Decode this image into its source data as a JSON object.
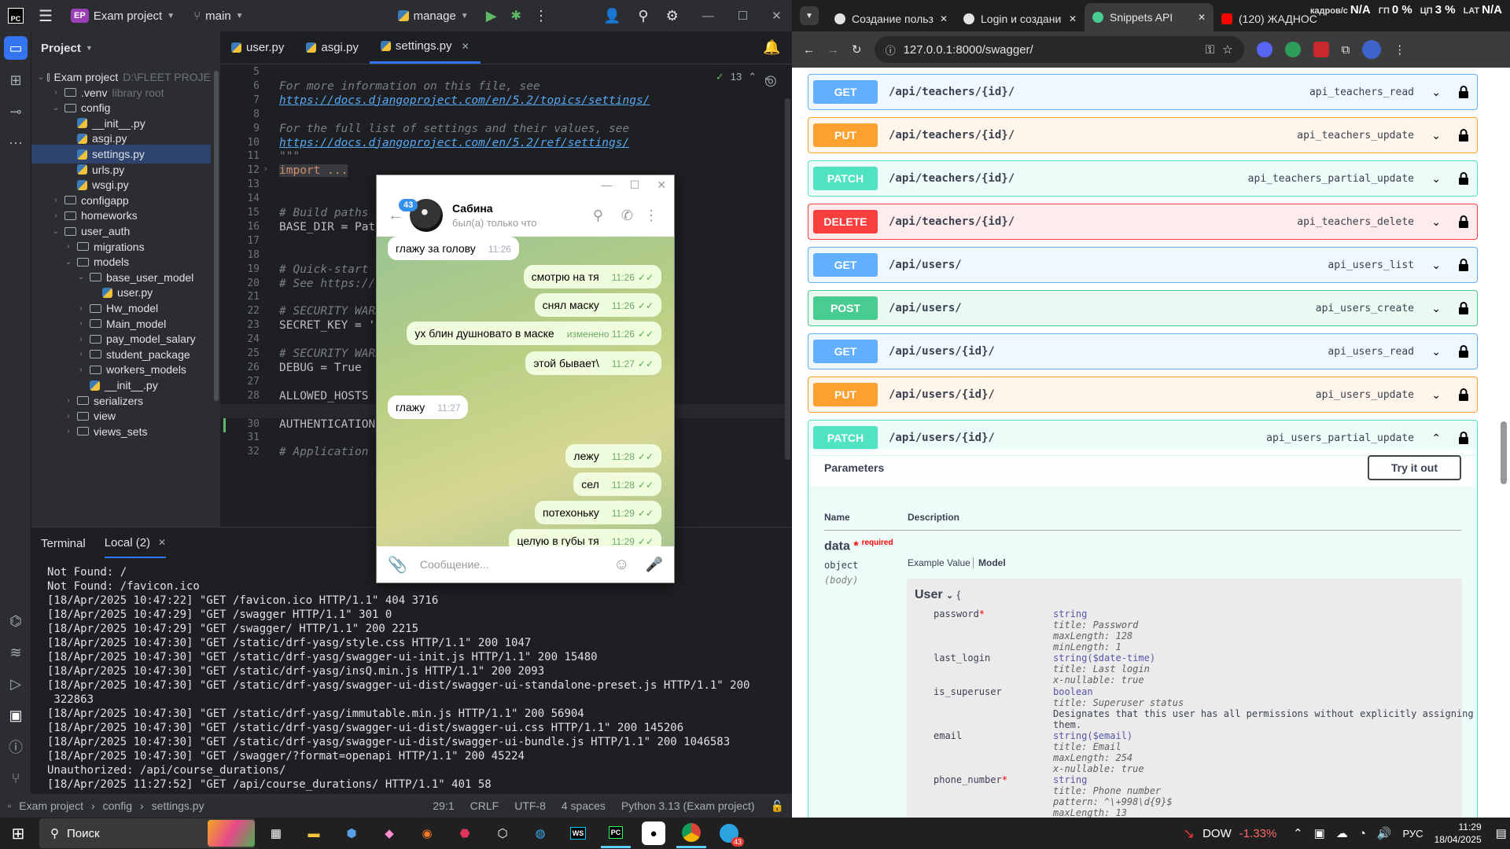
{
  "ide": {
    "logo": "PC",
    "project_badge": "EP",
    "project_name": "Exam project",
    "branch": "main",
    "run_config": "manage",
    "panel_title": "Project",
    "tree": [
      {
        "label": "Exam project",
        "hint": "D:\\FLEET PROJE",
        "kind": "folder",
        "depth": 0,
        "open": true
      },
      {
        "label": ".venv",
        "hint": "library root",
        "kind": "folder",
        "depth": 1,
        "open": false
      },
      {
        "label": "config",
        "hint": "",
        "kind": "folder",
        "depth": 1,
        "open": true
      },
      {
        "label": "__init__.py",
        "hint": "",
        "kind": "py",
        "depth": 2
      },
      {
        "label": "asgi.py",
        "hint": "",
        "kind": "py",
        "depth": 2
      },
      {
        "label": "settings.py",
        "hint": "",
        "kind": "py",
        "depth": 2,
        "selected": true
      },
      {
        "label": "urls.py",
        "hint": "",
        "kind": "py",
        "depth": 2
      },
      {
        "label": "wsgi.py",
        "hint": "",
        "kind": "py",
        "depth": 2
      },
      {
        "label": "configapp",
        "hint": "",
        "kind": "folder",
        "depth": 1,
        "open": false
      },
      {
        "label": "homeworks",
        "hint": "",
        "kind": "folder",
        "depth": 1,
        "open": false
      },
      {
        "label": "user_auth",
        "hint": "",
        "kind": "folder",
        "depth": 1,
        "open": true
      },
      {
        "label": "migrations",
        "hint": "",
        "kind": "folder",
        "depth": 2,
        "open": false
      },
      {
        "label": "models",
        "hint": "",
        "kind": "folder",
        "depth": 2,
        "open": true
      },
      {
        "label": "base_user_model",
        "hint": "",
        "kind": "folder",
        "depth": 3,
        "open": true
      },
      {
        "label": "user.py",
        "hint": "",
        "kind": "py",
        "depth": 4
      },
      {
        "label": "Hw_model",
        "hint": "",
        "kind": "folder",
        "depth": 3,
        "open": false
      },
      {
        "label": "Main_model",
        "hint": "",
        "kind": "folder",
        "depth": 3,
        "open": false
      },
      {
        "label": "pay_model_salary",
        "hint": "",
        "kind": "folder",
        "depth": 3,
        "open": false
      },
      {
        "label": "student_package",
        "hint": "",
        "kind": "folder",
        "depth": 3,
        "open": false
      },
      {
        "label": "workers_models",
        "hint": "",
        "kind": "folder",
        "depth": 3,
        "open": false
      },
      {
        "label": "__init__.py",
        "hint": "",
        "kind": "py",
        "depth": 3
      },
      {
        "label": "serializers",
        "hint": "",
        "kind": "folder",
        "depth": 2,
        "open": false
      },
      {
        "label": "view",
        "hint": "",
        "kind": "folder",
        "depth": 2,
        "open": false
      },
      {
        "label": "views_sets",
        "hint": "",
        "kind": "folder",
        "depth": 2,
        "open": false
      }
    ],
    "tabs": [
      "user.py",
      "asgi.py",
      "settings.py"
    ],
    "active_tab": "settings.py",
    "inspection_count": "13",
    "lines": [
      {
        "n": "5",
        "t": ""
      },
      {
        "n": "6",
        "t": "For more information on this file, see",
        "c": "cm"
      },
      {
        "n": "7",
        "t": "https://docs.djangoproject.com/en/5.2/topics/settings/",
        "c": "lk"
      },
      {
        "n": "8",
        "t": ""
      },
      {
        "n": "9",
        "t": "For the full list of settings and their values, see",
        "c": "cm"
      },
      {
        "n": "10",
        "t": "https://docs.djangoproject.com/en/5.2/ref/settings/",
        "c": "lk"
      },
      {
        "n": "11",
        "t": "\"\"\"",
        "c": "cm"
      },
      {
        "n": "12",
        "t": "import ...",
        "c": "kw"
      },
      {
        "n": "13",
        "t": ""
      },
      {
        "n": "14",
        "t": ""
      },
      {
        "n": "15",
        "t": "# Build paths i",
        "c": "cm"
      },
      {
        "n": "16",
        "t": "BASE_DIR = Path",
        "c": ""
      },
      {
        "n": "17",
        "t": ""
      },
      {
        "n": "18",
        "t": ""
      },
      {
        "n": "19",
        "t": "# Quick-start de",
        "c": "cm"
      },
      {
        "n": "20",
        "t": "# See https://d",
        "c": "cm"
      },
      {
        "n": "21",
        "t": ""
      },
      {
        "n": "22",
        "t": "# SECURITY WARNI",
        "c": "cm"
      },
      {
        "n": "23",
        "t": "SECRET_KEY = 'dj",
        "c": ""
      },
      {
        "n": "24",
        "t": ""
      },
      {
        "n": "25",
        "t": "# SECURITY WARNI",
        "c": "cm"
      },
      {
        "n": "26",
        "t": "DEBUG = True",
        "c": ""
      },
      {
        "n": "27",
        "t": ""
      },
      {
        "n": "28",
        "t": "ALLOWED_HOSTS =",
        "c": ""
      },
      {
        "n": "29",
        "t": ""
      },
      {
        "n": "30",
        "t": "AUTHENTICATION_",
        "c": ""
      },
      {
        "n": "31",
        "t": ""
      },
      {
        "n": "32",
        "t": "# Application de",
        "c": "cm"
      }
    ],
    "right_fragments": {
      "l15": ".",
      "l20": "ecklist/",
      "l22": "et!",
      "l23": "l=5n-q#&^3!y",
      "l25": "n!",
      "l30": "ackend']"
    },
    "terminal_tabs": [
      "Terminal",
      "Local (2)"
    ],
    "terminal_lines": [
      "Not Found: /",
      "Not Found: /favicon.ico",
      "[18/Apr/2025 10:47:22] \"GET /favicon.ico HTTP/1.1\" 404 3716",
      "[18/Apr/2025 10:47:29] \"GET /swagger HTTP/1.1\" 301 0",
      "[18/Apr/2025 10:47:29] \"GET /swagger/ HTTP/1.1\" 200 2215",
      "[18/Apr/2025 10:47:30] \"GET /static/drf-yasg/style.css HTTP/1.1\" 200 1047",
      "[18/Apr/2025 10:47:30] \"GET /static/drf-yasg/swagger-ui-init.js HTTP/1.1\" 200 15480",
      "[18/Apr/2025 10:47:30] \"GET /static/drf-yasg/insQ.min.js HTTP/1.1\" 200 2093",
      "[18/Apr/2025 10:47:30] \"GET /static/drf-yasg/swagger-ui-dist/swagger-ui-standalone-preset.js HTTP/1.1\" 200",
      " 322863",
      "[18/Apr/2025 10:47:30] \"GET /static/drf-yasg/immutable.min.js HTTP/1.1\" 200 56904",
      "[18/Apr/2025 10:47:30] \"GET /static/drf-yasg/swagger-ui-dist/swagger-ui.css HTTP/1.1\" 200 145206",
      "[18/Apr/2025 10:47:30] \"GET /static/drf-yasg/swagger-ui-dist/swagger-ui-bundle.js HTTP/1.1\" 200 1046583",
      "[18/Apr/2025 10:47:30] \"GET /swagger/?format=openapi HTTP/1.1\" 200 45224",
      "Unauthorized: /api/course_durations/",
      "[18/Apr/2025 11:27:52] \"GET /api/course_durations/ HTTP/1.1\" 401 58"
    ],
    "status": {
      "crumb1": "Exam project",
      "crumb2": "config",
      "crumb3": "settings.py",
      "position": "29:1",
      "line_ending": "CRLF",
      "encoding": "UTF-8",
      "indent": "4 spaces",
      "interpreter": "Python 3.13 (Exam project)"
    }
  },
  "telegram": {
    "contact": "Сабина",
    "status": "был(а) только что",
    "unread": "43",
    "input_placeholder": "Сообщение...",
    "messages": [
      {
        "text": "глажу за голову",
        "time": "11:26",
        "out": false
      },
      {
        "text": "смотрю на тя",
        "time": "11:26",
        "out": true
      },
      {
        "text": "снял маску",
        "time": "11:26",
        "out": true
      },
      {
        "text": "ух блин душновато в маске",
        "time": "изменено 11:26",
        "out": true
      },
      {
        "text": "этой бывает\\",
        "time": "11:27",
        "out": true
      },
      {
        "text": "глажу",
        "time": "11:27",
        "out": false
      },
      {
        "text": "лежу",
        "time": "11:28",
        "out": true
      },
      {
        "text": "сел",
        "time": "11:28",
        "out": true
      },
      {
        "text": "потехоньку",
        "time": "11:29",
        "out": true
      },
      {
        "text": "целую в губы тя",
        "time": "11:29",
        "out": true
      }
    ]
  },
  "browser": {
    "tabs": [
      {
        "title": "Создание польз",
        "active": false
      },
      {
        "title": "Login и создани",
        "active": false
      },
      {
        "title": "Snippets API",
        "active": true
      },
      {
        "title": "(120) ЖАДНОС",
        "active": false
      }
    ],
    "overlay_stats": [
      "N/A",
      "0 %",
      "3 %",
      "N/A"
    ],
    "overlay_labels": [
      "кадров/с",
      "ГП",
      "ЦП",
      "LAT"
    ],
    "url": "127.0.0.1:8000/swagger/",
    "operations": [
      {
        "method": "GET",
        "path": "/api/teachers/{id}/",
        "id": "api_teachers_read"
      },
      {
        "method": "PUT",
        "path": "/api/teachers/{id}/",
        "id": "api_teachers_update"
      },
      {
        "method": "PATCH",
        "path": "/api/teachers/{id}/",
        "id": "api_teachers_partial_update"
      },
      {
        "method": "DELETE",
        "path": "/api/teachers/{id}/",
        "id": "api_teachers_delete"
      },
      {
        "method": "GET",
        "path": "/api/users/",
        "id": "api_users_list"
      },
      {
        "method": "POST",
        "path": "/api/users/",
        "id": "api_users_create"
      },
      {
        "method": "GET",
        "path": "/api/users/{id}/",
        "id": "api_users_read"
      },
      {
        "method": "PUT",
        "path": "/api/users/{id}/",
        "id": "api_users_update"
      },
      {
        "method": "PATCH",
        "path": "/api/users/{id}/",
        "id": "api_users_partial_update",
        "expanded": true
      }
    ],
    "params": {
      "title": "Parameters",
      "try_label": "Try it out",
      "col_name": "Name",
      "col_desc": "Description",
      "param_name": "data",
      "required_mark": "*",
      "required_label": "required",
      "param_type": "object",
      "param_in": "(body)",
      "example_tab": "Example Value",
      "model_tab": "Model",
      "model_name": "User",
      "model_brace": "{"
    },
    "fields": [
      {
        "name": "password",
        "req": true,
        "lines": [
          "string",
          "title: Password",
          "maxLength: 128",
          "minLength: 1"
        ]
      },
      {
        "name": "last_login",
        "req": false,
        "lines": [
          "string($date-time)",
          "title: Last login",
          "x-nullable: true"
        ]
      },
      {
        "name": "is_superuser",
        "req": false,
        "lines": [
          "boolean",
          "title: Superuser status",
          "Designates that this user has all permissions without explicitly assigning",
          "them."
        ]
      },
      {
        "name": "email",
        "req": false,
        "lines": [
          "string($email)",
          "title: Email",
          "maxLength: 254",
          "x-nullable: true"
        ]
      },
      {
        "name": "phone_number",
        "req": true,
        "lines": [
          "string",
          "title: Phone number",
          "pattern: ^\\+998\\d{9}$",
          "maxLength: 13"
        ]
      }
    ]
  },
  "taskbar": {
    "search": "Поиск",
    "ticker": "DOW",
    "ticker_change": "-1.33%",
    "lang": "РУС",
    "time": "11:29",
    "date": "18/04/2025",
    "telegram_badge": "43"
  },
  "colors": {
    "get": "#61affe",
    "put": "#fca130",
    "patch": "#50e3c2",
    "delete": "#f93e3e",
    "post": "#49cc90"
  }
}
